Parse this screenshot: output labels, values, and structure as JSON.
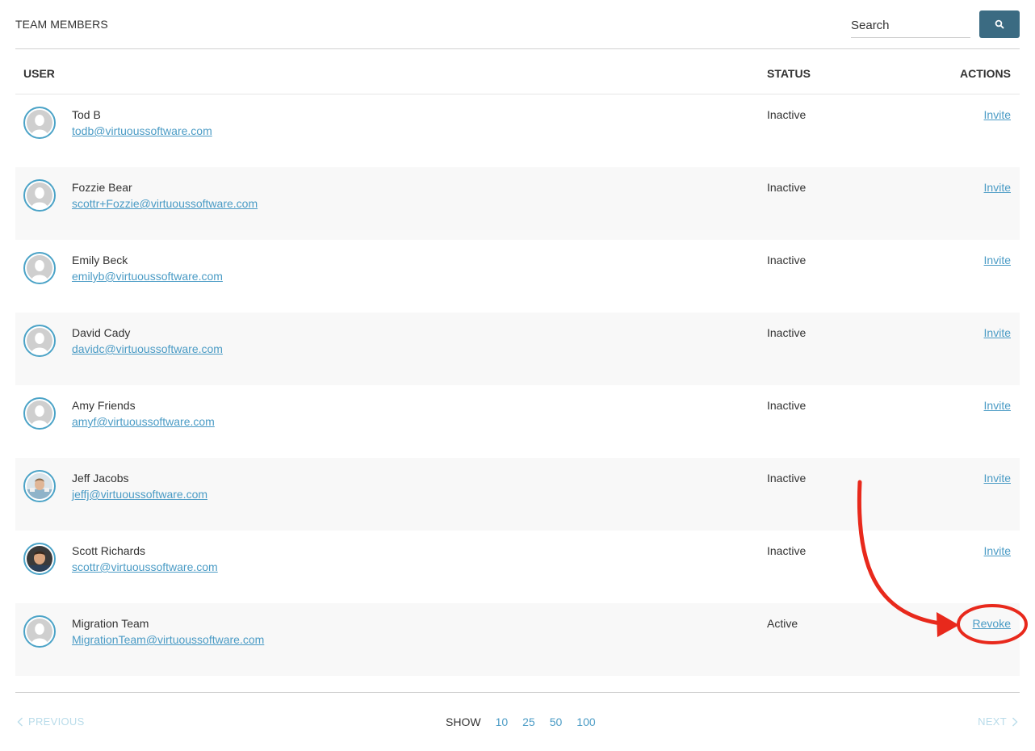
{
  "header": {
    "title": "TEAM MEMBERS",
    "search_placeholder": "Search",
    "search_icon": "search-icon"
  },
  "table": {
    "columns": {
      "user": "USER",
      "status": "STATUS",
      "actions": "ACTIONS"
    },
    "rows": [
      {
        "name": "Tod B",
        "email": "todb@virtuoussoftware.com",
        "status": "Inactive",
        "action": "Invite",
        "avatar": "default-avatar-icon"
      },
      {
        "name": "Fozzie Bear",
        "email": "scottr+Fozzie@virtuoussoftware.com",
        "status": "Inactive",
        "action": "Invite",
        "avatar": "default-avatar-icon"
      },
      {
        "name": "Emily Beck",
        "email": "emilyb@virtuoussoftware.com",
        "status": "Inactive",
        "action": "Invite",
        "avatar": "default-avatar-icon"
      },
      {
        "name": "David Cady",
        "email": "davidc@virtuoussoftware.com",
        "status": "Inactive",
        "action": "Invite",
        "avatar": "default-avatar-icon"
      },
      {
        "name": "Amy Friends",
        "email": "amyf@virtuoussoftware.com",
        "status": "Inactive",
        "action": "Invite",
        "avatar": "default-avatar-icon"
      },
      {
        "name": "Jeff Jacobs",
        "email": "jeffj@virtuoussoftware.com",
        "status": "Inactive",
        "action": "Invite",
        "avatar": "photo-avatar"
      },
      {
        "name": "Scott Richards",
        "email": "scottr@virtuoussoftware.com",
        "status": "Inactive",
        "action": "Invite",
        "avatar": "photo-avatar"
      },
      {
        "name": "Migration Team",
        "email": "MigrationTeam@virtuoussoftware.com",
        "status": "Active",
        "action": "Revoke",
        "avatar": "default-avatar-icon"
      }
    ]
  },
  "pagination": {
    "previous": "PREVIOUS",
    "next": "NEXT",
    "show_label": "SHOW",
    "page_sizes": [
      "10",
      "25",
      "50",
      "100"
    ]
  },
  "colors": {
    "accent": "#4a9bc5",
    "search_button": "#3b6b82",
    "annotation": "#e8291c",
    "alt_row": "#f8f8f8"
  }
}
